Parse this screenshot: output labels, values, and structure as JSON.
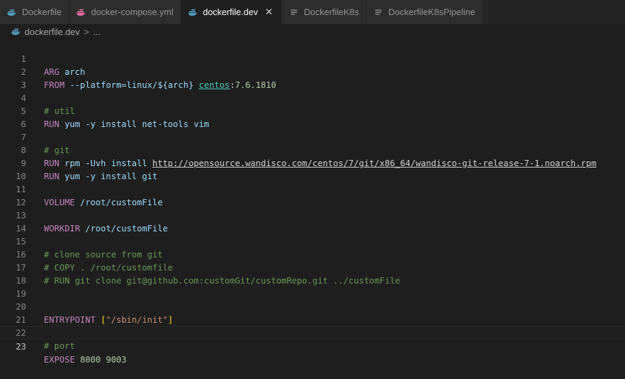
{
  "tabs": [
    {
      "label": "Dockerfile",
      "icon": "docker-icon",
      "active": false
    },
    {
      "label": "docker-compose.yml",
      "icon": "docker-compose-icon",
      "active": false
    },
    {
      "label": "dockerfile.dev",
      "icon": "docker-icon",
      "active": true,
      "close": "✕"
    },
    {
      "label": "DockerfileK8s",
      "icon": "lines-icon",
      "active": false
    },
    {
      "label": "DockerfileK8sPipeline",
      "icon": "lines-icon",
      "active": false
    }
  ],
  "breadcrumb": {
    "file": "dockerfile.dev",
    "separator": ">",
    "more": "..."
  },
  "colors": {
    "docker_blue": "#519aba",
    "compose_pink": "#e06c9f",
    "keyword": "#c586c0",
    "comment": "#6a9955",
    "string": "#ce9178"
  },
  "editor": {
    "current_line": 23,
    "lines": [
      {
        "n": "1",
        "kw": "ARG",
        "rest": " arch"
      },
      {
        "n": "2",
        "kw": "FROM",
        "p1": " --platform=linux/${",
        "var": "arch",
        "p2": "} ",
        "image": "centos",
        "colon": ":",
        "tag": "7.6.1810"
      },
      {
        "n": "3"
      },
      {
        "n": "4",
        "comment": "# util"
      },
      {
        "n": "5",
        "kw": "RUN",
        "rest": " yum -y install net-tools vim"
      },
      {
        "n": "6"
      },
      {
        "n": "7",
        "comment": "# git"
      },
      {
        "n": "8",
        "kw": "RUN",
        "rest": " rpm -Uvh install ",
        "url": "http://opensource.wandisco.com/centos/7/git/x86_64/wandisco-git-release-7-1.noarch.rpm"
      },
      {
        "n": "9",
        "kw": "RUN",
        "rest": " yum -y install git"
      },
      {
        "n": "10"
      },
      {
        "n": "11",
        "kw": "VOLUME",
        "rest": " /root/customFile"
      },
      {
        "n": "12"
      },
      {
        "n": "13",
        "kw": "WORKDIR",
        "rest": " /root/customFile"
      },
      {
        "n": "14"
      },
      {
        "n": "15",
        "comment": "# clone source from git"
      },
      {
        "n": "16",
        "comment": "# COPY . /root/customfile"
      },
      {
        "n": "17",
        "comment": "# RUN git clone git@github.com:customGit/customRepo.git ../customFile"
      },
      {
        "n": "18"
      },
      {
        "n": "19"
      },
      {
        "n": "20",
        "kw": "ENTRYPOINT",
        "sp": " ",
        "lb": "[",
        "str": "\"/sbin/init\"",
        "rb": "]"
      },
      {
        "n": "21"
      },
      {
        "n": "22",
        "comment": "# port"
      },
      {
        "n": "23",
        "kw": "EXPOSE",
        "sp": " ",
        "nums": "8000 9003"
      }
    ]
  }
}
